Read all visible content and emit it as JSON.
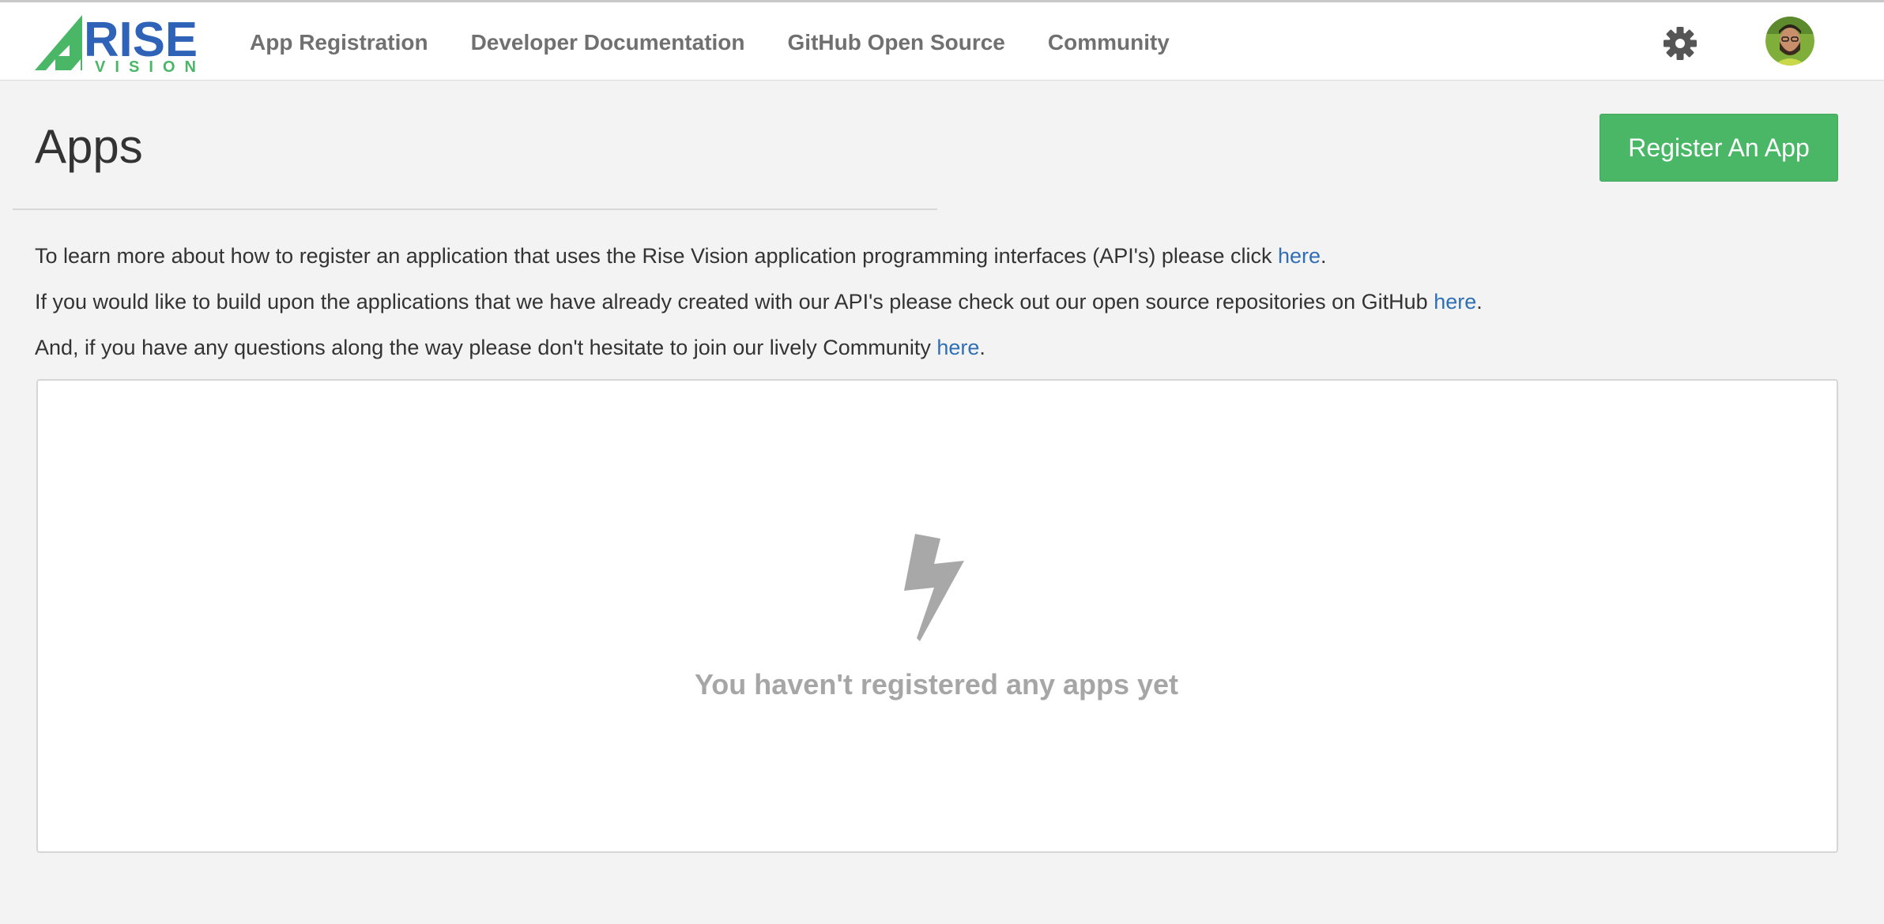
{
  "header": {
    "logo": {
      "text": "RISE",
      "subtext": "VISION",
      "brand_blue": "#2f63b7",
      "brand_green": "#4ab767"
    },
    "nav": [
      {
        "label": "App Registration"
      },
      {
        "label": "Developer Documentation"
      },
      {
        "label": "GitHub Open Source"
      },
      {
        "label": "Community"
      }
    ],
    "settings_icon": "gear-icon",
    "avatar_icon": "user-avatar"
  },
  "main": {
    "title": "Apps",
    "register_button": "Register An App",
    "intro": [
      {
        "text": "To learn more about how to register an application that uses the Rise Vision application programming interfaces (API's) please click ",
        "link": "here",
        "end": "."
      },
      {
        "text": "If you would like to build upon the applications that we have already created with our API's please check out our open source repositories on GitHub ",
        "link": "here",
        "end": "."
      },
      {
        "text": "And, if you have any questions along the way please don't hesitate to join our lively Community ",
        "link": "here",
        "end": "."
      }
    ],
    "empty_state": {
      "icon": "lightning-bolt-icon",
      "message": "You haven't registered any apps yet"
    }
  },
  "colors": {
    "accent_green": "#4ab767",
    "link_blue": "#2f6fb6",
    "nav_gray": "#707070",
    "empty_gray": "#a6a6a6"
  }
}
